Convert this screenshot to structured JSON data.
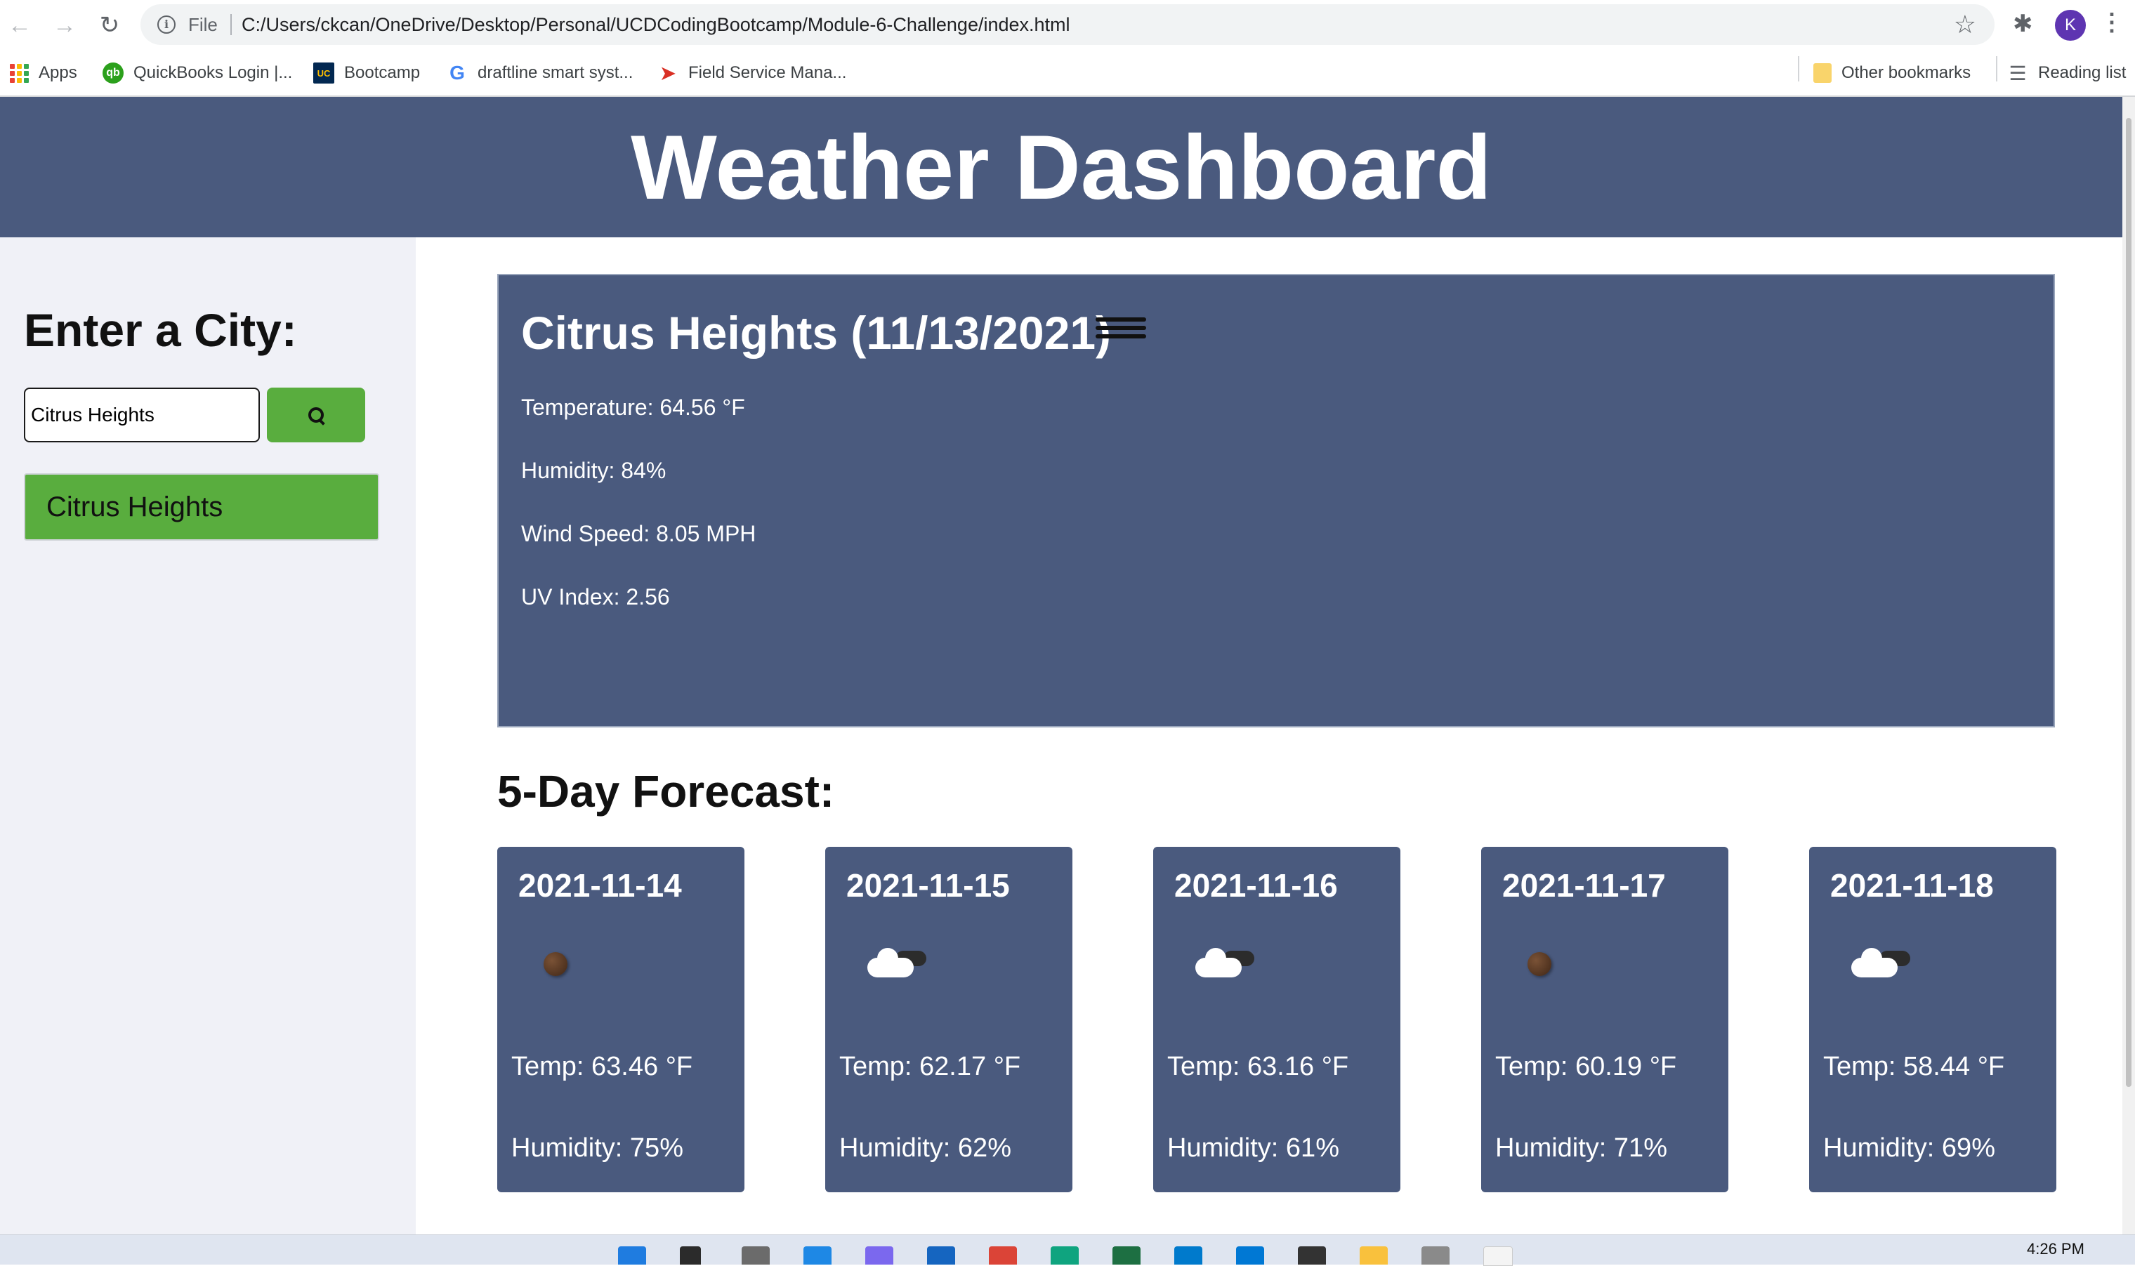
{
  "browser": {
    "scheme_label": "File",
    "url": "C:/Users/ckcan/OneDrive/Desktop/Personal/UCDCodingBootcamp/Module-6-Challenge/index.html",
    "avatar_initial": "K",
    "bookmarks": [
      {
        "label": "Apps",
        "icon": "apps-grid-icon"
      },
      {
        "label": "QuickBooks Login |...",
        "icon": "quickbooks-icon"
      },
      {
        "label": "Bootcamp",
        "icon": "uc-davis-icon"
      },
      {
        "label": "draftline smart syst...",
        "icon": "google-icon"
      },
      {
        "label": "Field Service Mana...",
        "icon": "field-service-icon"
      },
      {
        "label": "Other bookmarks",
        "icon": "folder-icon"
      },
      {
        "label": "Reading list",
        "icon": "reading-list-icon"
      }
    ]
  },
  "page": {
    "title": "Weather Dashboard",
    "sidebar": {
      "heading": "Enter a City:",
      "input_value": "Citrus Heights",
      "history": [
        "Citrus Heights"
      ]
    },
    "current": {
      "title": "Citrus Heights (11/13/2021)",
      "icon": "mist-icon",
      "temperature": "Temperature: 64.56 °F",
      "humidity": "Humidity: 84%",
      "wind": "Wind Speed: 8.05 MPH",
      "uv": "UV Index: 2.56"
    },
    "forecast_heading": "5-Day Forecast:",
    "forecast": [
      {
        "date": "2021-11-14",
        "icon": "clear-night-icon",
        "temp": "Temp: 63.46 °F",
        "humidity": "Humidity: 75%"
      },
      {
        "date": "2021-11-15",
        "icon": "broken-clouds-icon",
        "temp": "Temp: 62.17 °F",
        "humidity": "Humidity: 62%"
      },
      {
        "date": "2021-11-16",
        "icon": "broken-clouds-icon",
        "temp": "Temp: 63.16 °F",
        "humidity": "Humidity: 61%"
      },
      {
        "date": "2021-11-17",
        "icon": "clear-night-icon",
        "temp": "Temp: 60.19 °F",
        "humidity": "Humidity: 71%"
      },
      {
        "date": "2021-11-18",
        "icon": "broken-clouds-icon",
        "temp": "Temp: 58.44 °F",
        "humidity": "Humidity: 69%"
      }
    ]
  },
  "taskbar": {
    "time": "4:26 PM"
  },
  "colors": {
    "header": "#4a5a7e",
    "button": "#59ad3e",
    "sidebar": "#f0f1f7"
  }
}
